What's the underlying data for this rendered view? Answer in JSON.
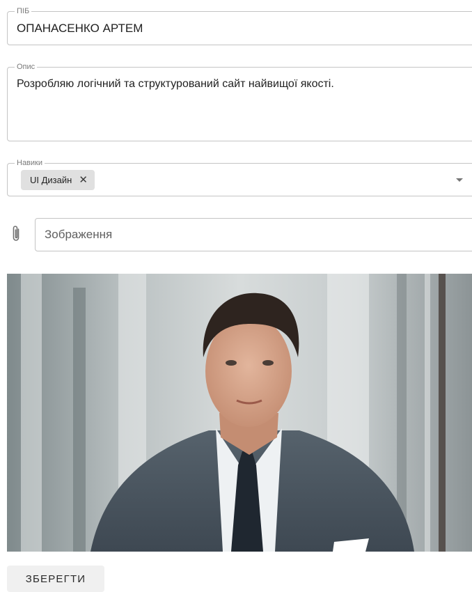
{
  "form": {
    "name": {
      "label": "ПІБ",
      "value": "ОПАНАСЕНКО АРТЕМ"
    },
    "description": {
      "label": "Опис",
      "value": "Розробляю логічний та структурований сайт найвищої якості."
    },
    "skills": {
      "label": "Навики",
      "chips": [
        {
          "label": "UI Дизайн",
          "delete_icon": "close-icon"
        }
      ],
      "arrow_icon": "chevron-down-icon"
    },
    "image": {
      "attach_icon": "paperclip-icon",
      "placeholder": "Зображення"
    },
    "photo": {
      "subject": "portrait-photo"
    },
    "save_label": "ЗБЕРЕГТИ"
  },
  "colors": {
    "border": "#c4c4c4",
    "chip_bg": "#e0e0e0",
    "button_bg": "#f0f0f0",
    "text": "#1f1f1f",
    "label": "#7a7a7a"
  }
}
